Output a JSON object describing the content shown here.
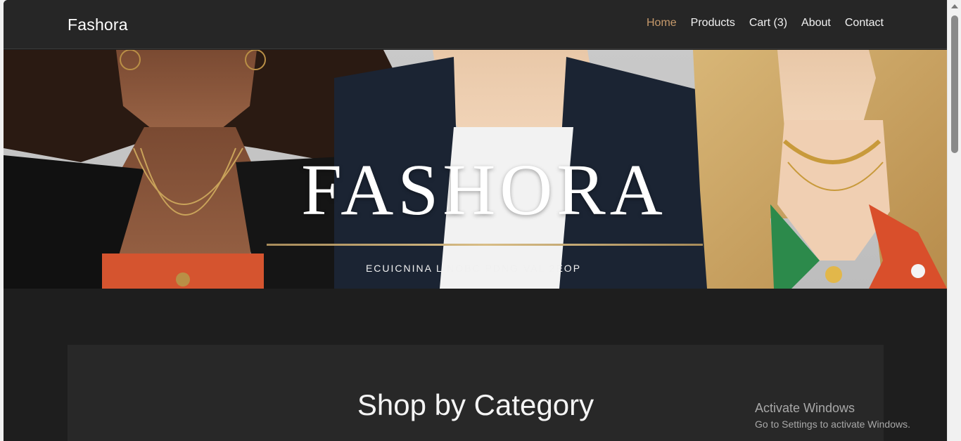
{
  "navbar": {
    "brand": "Fashora",
    "links": [
      {
        "label": "Home",
        "active": true
      },
      {
        "label": "Products",
        "active": false
      },
      {
        "label": "Cart (3)",
        "active": false
      },
      {
        "label": "About",
        "active": false
      },
      {
        "label": "Contact",
        "active": false
      }
    ],
    "active_color": "#c79a6b"
  },
  "hero": {
    "title": "FASHORA",
    "subtitle": "ECUICNINA L NOBC PDNG VAL 2EOP",
    "image_description_icon": "fashion-models-hero-image"
  },
  "category_section": {
    "title": "Shop by Category"
  },
  "watermark": {
    "line1": "Activate Windows",
    "line2": "Go to Settings to activate Windows."
  },
  "colors": {
    "page_bg": "#1e1e1e",
    "navbar_bg": "#262626",
    "section_bg": "#282828",
    "accent": "#c79a6b"
  }
}
